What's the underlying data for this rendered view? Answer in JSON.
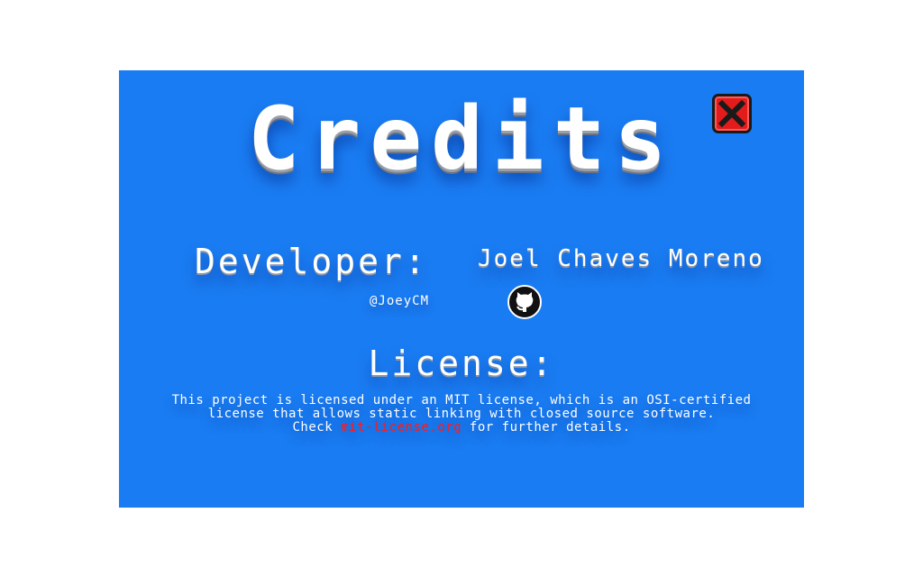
{
  "dialog": {
    "title": "Credits",
    "close_icon": "close-icon",
    "background_color": "#1a7cf2",
    "close_color": "#e41b1b"
  },
  "developer": {
    "label": "Developer:",
    "name": "Joel Chaves Moreno",
    "handle": "@JoeyCM",
    "github_icon": "github-icon"
  },
  "license": {
    "label": "License:",
    "line1": "This project is licensed under an MIT license, which is an OSI-certified",
    "line2": "license that allows static linking with closed source software.",
    "line3_prefix": "Check ",
    "link_text": "mit-license.org",
    "line3_suffix": " for further details.",
    "link_color": "#ff1a1a"
  }
}
